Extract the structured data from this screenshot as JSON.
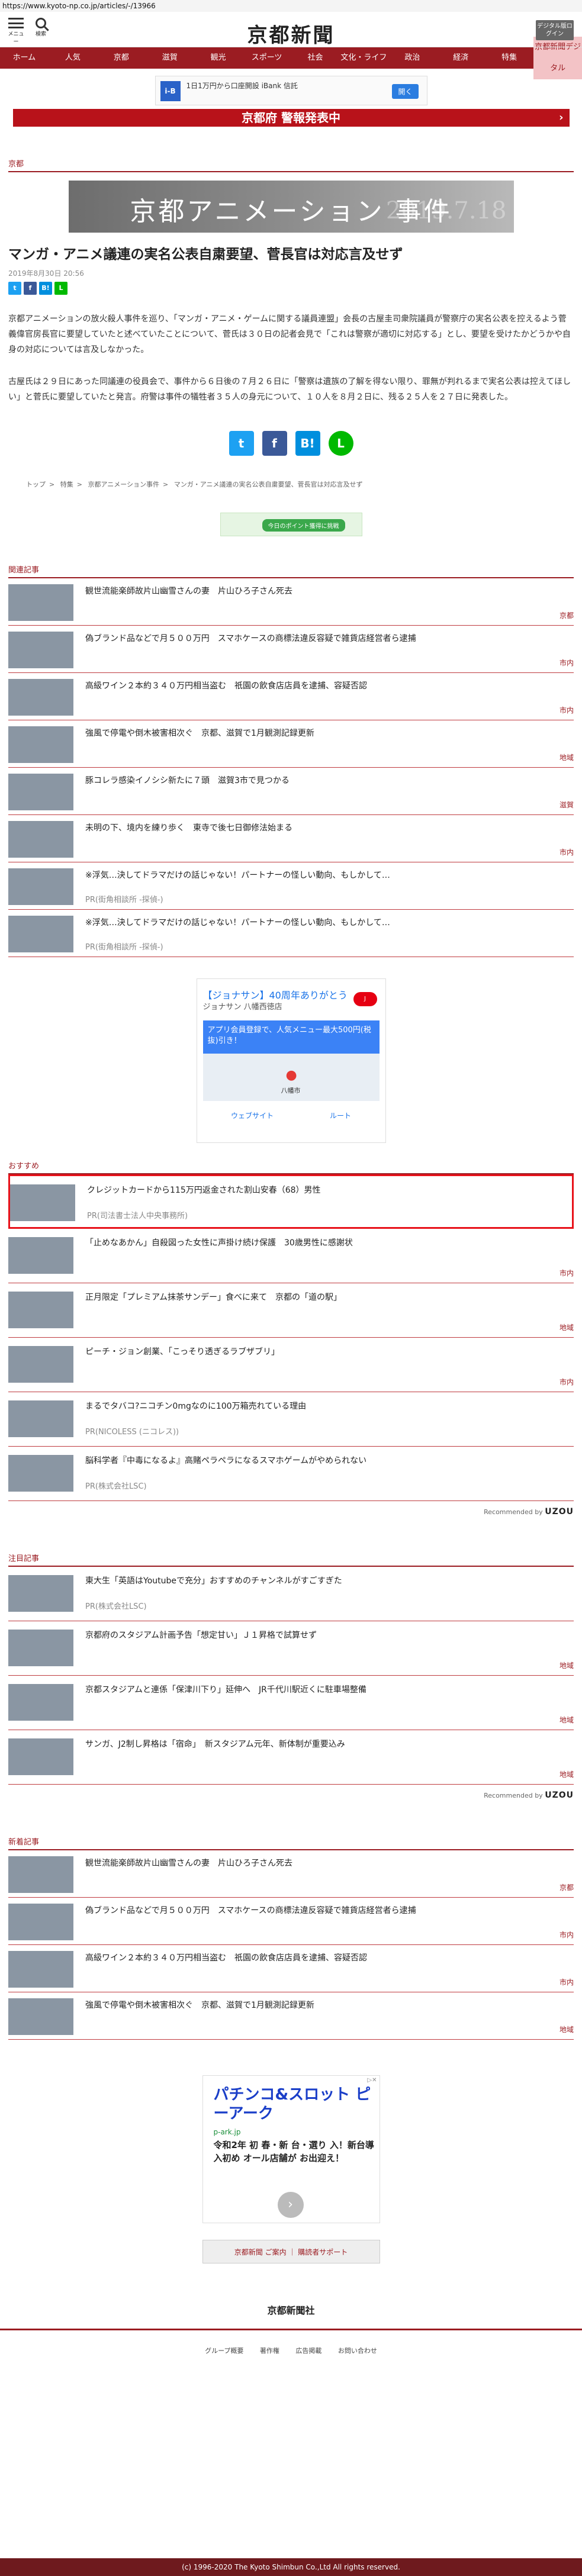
{
  "url": "https://www.kyoto-np.co.jp/articles/-/13966",
  "header": {
    "menu_label": "メニュー",
    "search_label": "検索",
    "logo": "京都新聞",
    "digital_label": "デジタル版ログイン"
  },
  "gnav": [
    "ホーム",
    "人気",
    "京都",
    "滋賀",
    "観光",
    "スポーツ",
    "社会",
    "文化・ライフ",
    "政治",
    "経済",
    "特集",
    "京都新聞デジタル"
  ],
  "ad_top": {
    "icon": "i-B",
    "text": "1日1万円から口座開設 iBank 信託",
    "button": "開く"
  },
  "alert": "京都府 警報発表中",
  "section_kyoto": "京都",
  "hero": {
    "title": "京都アニメーション 事件",
    "date_mark": "2019.7.18"
  },
  "article": {
    "title": "マンガ・アニメ議連の実名公表自粛要望、菅長官は対応言及せず",
    "date": "2019年8月30日 20:56",
    "p1": "京都アニメーションの放火殺人事件を巡り、「マンガ・アニメ・ゲームに関する議員連盟」会長の古屋圭司衆院議員が警察庁の実名公表を控えるよう菅義偉官房長官に要望していたと述べていたことについて、菅氏は３０日の記者会見で「これは警察が適切に対応する」とし、要望を受けたかどうかや自身の対応については言及しなかった。",
    "p2": "古屋氏は２９日にあった同議連の役員会で、事件から６日後の７月２６日に「警察は遺族の了解を得ない限り、罪無が判れるまで実名公表は控えてほしい」と菅氏に要望していたと発言。府警は事件の犠牲者３５人の身元について、１０人を８月２日に、残る２５人を２７日に発表した。"
  },
  "share": {
    "tw": "t",
    "fb": "f",
    "hb": "B!",
    "ln": "LINE"
  },
  "breadcrumb": [
    "トップ",
    "特集",
    "京都アニメーション事件",
    "マンガ・アニメ議連の実名公表自粛要望、菅長官は対応言及せず"
  ],
  "ad_mid": {
    "button": "今日のポイント獲得に挑戦"
  },
  "related": {
    "label": "関連記事",
    "items": [
      {
        "title": "観世流能楽師故片山幽雪さんの妻　片山ひろ子さん死去",
        "tag": "京都"
      },
      {
        "title": "偽ブランド品などで月５００万円　スマホケースの商標法違反容疑で雑貨店経営者ら逮捕",
        "tag": "市内"
      },
      {
        "title": "高級ワイン２本約３４０万円相当盗む　祇園の飲食店店員を逮捕、容疑否認",
        "tag": "市内"
      },
      {
        "title": "強風で停電や倒木被害相次ぐ　京都、滋賀で1月観測記録更新",
        "tag": "地域"
      },
      {
        "title": "豚コレラ感染イノシシ新たに７頭　滋賀3市で見つかる",
        "tag": "滋賀"
      },
      {
        "title": "未明の下、境内を練り歩く　東寺で後七日御修法始まる",
        "tag": "市内"
      },
      {
        "title": "※浮気…決してドラマだけの話じゃない！パートナーの怪しい動向、もしかして…",
        "pr": "PR(街角相談所 -探偵-)"
      },
      {
        "title": "※浮気…決してドラマだけの話じゃない！パートナーの怪しい動向、もしかして…",
        "pr": "PR(街角相談所 -探偵-)"
      }
    ]
  },
  "map_ad": {
    "title": "【ジョナサン】40周年ありがとう",
    "sub": "ジョナサン 八幡西徳店",
    "box": "アプリ会員登録で、人気メニュー最大500円(税抜)引き！",
    "place": "八幡市",
    "btn1": "ウェブサイト",
    "btn2": "ルート"
  },
  "recommend": {
    "label": "おすすめ",
    "items": [
      {
        "title": "クレジットカードから115万円返金された割山安春（68）男性",
        "pr": "PR(司法書士法人中央事務所)"
      },
      {
        "title": "「止めなあかん」自殺図った女性に声掛け続け保護　30歳男性に感謝状",
        "tag": "市内"
      },
      {
        "title": "正月限定「プレミアム抹茶サンデー」食べに来て　京都の「道の駅」",
        "tag": "地域"
      },
      {
        "title": "ピーチ・ジョン創業、「こっそり透ぎるラブザブリ」",
        "tag": "市内"
      },
      {
        "title": "まるでタバコ?ニコチン0mgなのに100万箱売れている理由",
        "pr": "PR(NICOLESS (ニコレス))"
      },
      {
        "title": "脳科学者『中毒になるよ』高賭ペラペラになるスマホゲームがやめられない",
        "pr": "PR(株式会社LSC)"
      }
    ],
    "by": "Recommended by",
    "brand": "UZOU"
  },
  "featured": {
    "label": "注目記事",
    "items": [
      {
        "title": "東大生「英語はYoutubeで充分」おすすめのチャンネルがすごすぎた",
        "pr": "PR(株式会社LSC)"
      },
      {
        "title": "京都府のスタジアム計画予告「想定甘い」Ｊ１昇格で試算せず",
        "tag": "地域"
      },
      {
        "title": "京都スタジアムと連係「保津川下り」延伸へ　JR千代川駅近くに駐車場整備",
        "tag": "地域"
      },
      {
        "title": "サンガ、J2制し昇格は「宿命」　新スタジアム元年、新体制が重要込み",
        "tag": "地域"
      }
    ],
    "by": "Recommended by",
    "brand": "UZOU"
  },
  "latest": {
    "label": "新着記事",
    "items": [
      {
        "title": "観世流能楽師故片山幽雪さんの妻　片山ひろ子さん死去",
        "tag": "京都"
      },
      {
        "title": "偽ブランド品などで月５００万円　スマホケースの商標法違反容疑で雑貨店経営者ら逮捕",
        "tag": "市内"
      },
      {
        "title": "高級ワイン２本約３４０万円相当盗む　祇園の飲食店店員を逮捕、容疑否認",
        "tag": "市内"
      },
      {
        "title": "強風で停電や倒木被害相次ぐ　京都、滋賀で1月観測記録更新",
        "tag": "地域"
      }
    ]
  },
  "bottom_ad": {
    "title": "パチンコ&スロット ピーアーク",
    "url": "p-ark.jp",
    "desc": "令和2年 初 春・新 台・選り 入！新台導入初め オール店舗が お出迎え！"
  },
  "footer": {
    "button": "京都新聞 ご案内 ｜ 購読者サポート",
    "logo": "京都新聞社",
    "links": [
      "グループ概要",
      "著作権",
      "広告掲載",
      "お問い合わせ"
    ],
    "copyright": "(c) 1996-2020 The Kyoto Shimbun Co.,Ltd All rights reserved."
  }
}
